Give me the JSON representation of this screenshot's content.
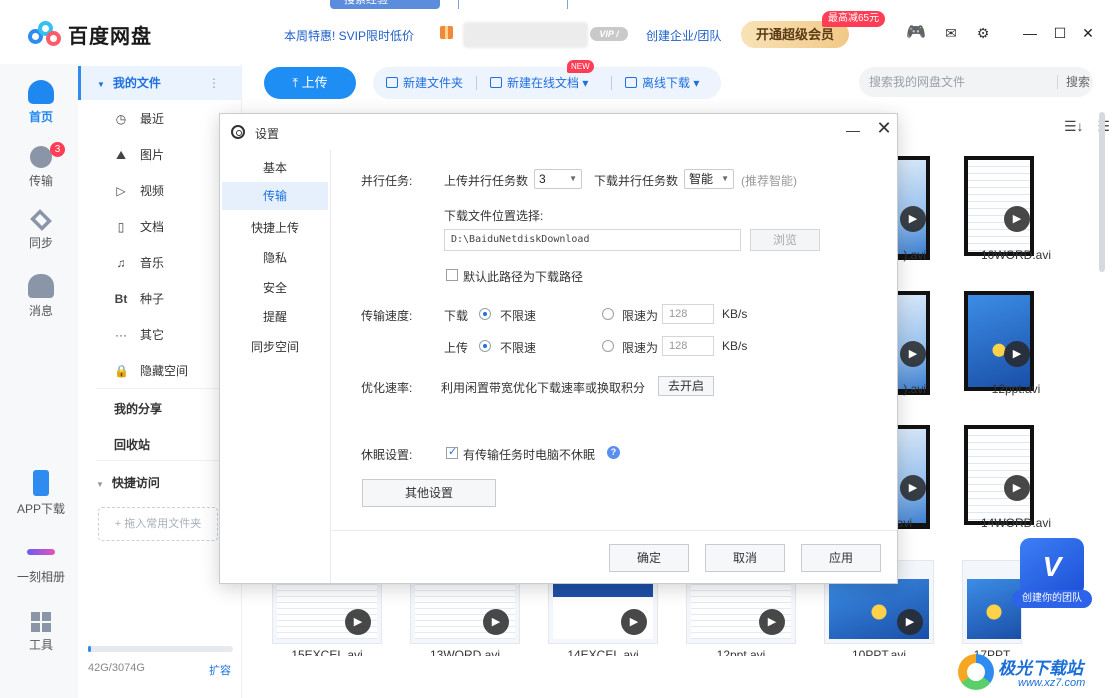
{
  "top_tabs": [
    "搜索经验",
    "发布经验"
  ],
  "app": {
    "logo_text": "百度网盘",
    "promo": "本周特惠! SVIP限时低价",
    "vip_badge": "VIP /",
    "enterprise_link": "创建企业/团队",
    "svip_button": "开通超级会员",
    "discount_tag": "最高减65元",
    "icons": [
      "game-icon",
      "mail-icon",
      "settings-icon"
    ],
    "window_controls": {
      "minimize": "—",
      "maximize": "☐",
      "close": "✕"
    }
  },
  "leftnav": {
    "items": [
      {
        "label": "首页",
        "icon": "cloud-home-icon"
      },
      {
        "label": "传输",
        "icon": "transfer-icon",
        "badge": "3"
      },
      {
        "label": "同步",
        "icon": "sync-icon"
      },
      {
        "label": "消息",
        "icon": "message-icon"
      },
      {
        "label": "APP下载",
        "icon": "phone-icon"
      },
      {
        "label": "一刻相册",
        "icon": "album-icon"
      },
      {
        "label": "工具",
        "icon": "tools-icon"
      }
    ]
  },
  "filebar": {
    "my_files": "我的文件",
    "more": "⋮",
    "categories": [
      {
        "label": "最近",
        "icon": "◷"
      },
      {
        "label": "图片",
        "icon": "⛰"
      },
      {
        "label": "视频",
        "icon": "▷"
      },
      {
        "label": "文档",
        "icon": "▯"
      },
      {
        "label": "音乐",
        "icon": "♫"
      },
      {
        "label": "种子",
        "icon": "Bt"
      },
      {
        "label": "其它",
        "icon": "···"
      },
      {
        "label": "隐藏空间",
        "icon": "🔒"
      }
    ],
    "my_share": "我的分享",
    "recycle_bin": "回收站",
    "quick_access": "快捷访问",
    "drop_hint": "+ 拖入常用文件夹",
    "storage": "42G/3074G",
    "storage_fraction": 0.014,
    "expand": "扩容"
  },
  "toolbar": {
    "upload": "上传",
    "new_folder": "新建文件夹",
    "new_online_doc": "新建在线文档",
    "new_badge": "NEW",
    "offline_download": "离线下载",
    "search_placeholder": "搜索我的网盘文件",
    "search_button": "搜索"
  },
  "grid": {
    "labels": [
      ").avi",
      "10WORD.avi",
      ").avi",
      "12ppt.avi",
      "avi",
      "14WORD.avi"
    ],
    "bottom_labels": [
      "15EXCEL.avi",
      "13WORD.avi",
      "14EXCEL.avi",
      "12ppt.avi",
      "10PPT.avi",
      "17PPT"
    ]
  },
  "team_badge": {
    "letter": "V",
    "label": "创建你的团队"
  },
  "watermark": {
    "title": "极光下载站",
    "url": "www.xz7.com"
  },
  "dialog": {
    "title": "设置",
    "menu": [
      "基本",
      "传输",
      "快捷上传",
      "隐私",
      "安全",
      "提醒",
      "同步空间"
    ],
    "active_menu": "传输",
    "parallel_label": "并行任务:",
    "upload_parallel_label": "上传并行任务数",
    "upload_parallel_value": "3",
    "download_parallel_label": "下载并行任务数",
    "download_parallel_value": "智能",
    "recommend_hint": "(推荐智能)",
    "download_location_label": "下载文件位置选择:",
    "download_path": "D:\\BaiduNetdiskDownload",
    "browse": "浏览",
    "default_path_checkbox": "默认此路径为下载路径",
    "speed_label": "传输速度:",
    "download_label": "下载",
    "upload_label": "上传",
    "unlimited": "不限速",
    "limit_to": "限速为",
    "download_limit_value": "128",
    "upload_limit_value": "128",
    "unit": "KB/s",
    "optimize_label": "优化速率:",
    "optimize_desc": "利用闲置带宽优化下载速率或换取积分",
    "optimize_button": "去开启",
    "sleep_label": "休眠设置:",
    "sleep_checkbox": "有传输任务时电脑不休眠",
    "other_settings": "其他设置",
    "ok": "确定",
    "cancel": "取消",
    "apply": "应用"
  }
}
